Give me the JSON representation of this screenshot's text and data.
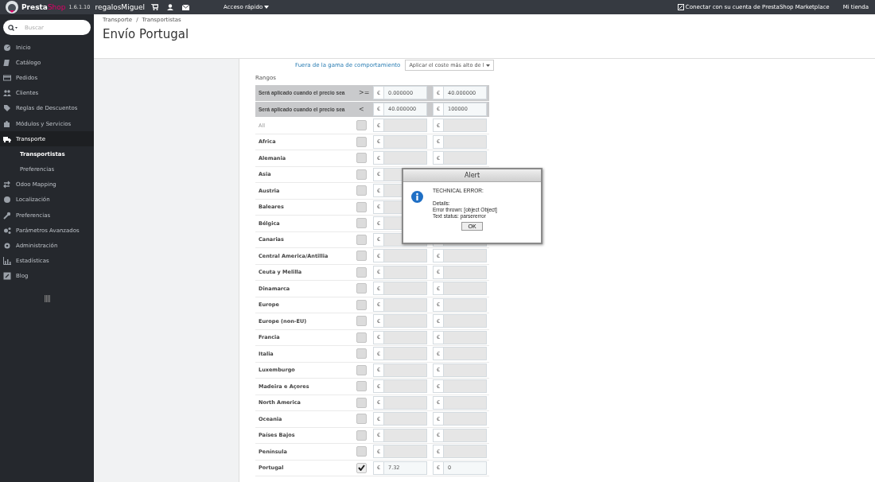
{
  "topbar": {
    "brand_main": "Presta",
    "brand_accent": "Shop",
    "version": "1.6.1.10",
    "shop_name": "regalosMiguel",
    "quick_access": "Acceso rápido",
    "marketplace_link": "Conectar con su cuenta de PrestaShop Marketplace",
    "my_shop": "Mi tienda"
  },
  "sidebar": {
    "search": {
      "placeholder": "Buscar"
    },
    "items": [
      {
        "label": "Inicio",
        "selected": false
      },
      {
        "label": "Catálogo",
        "selected": false
      },
      {
        "label": "Pedidos",
        "selected": false
      },
      {
        "label": "Clientes",
        "selected": false
      },
      {
        "label": "Reglas de Descuentos",
        "selected": false
      },
      {
        "label": "Módulos y Servicios",
        "selected": false
      },
      {
        "label": "Transporte",
        "selected": true,
        "children": [
          {
            "label": "Transportistas",
            "selected": true
          },
          {
            "label": "Preferencias",
            "selected": false
          }
        ]
      },
      {
        "label": "Odoo Mapping",
        "selected": false
      },
      {
        "label": "Localización",
        "selected": false
      },
      {
        "label": "Preferencias",
        "selected": false
      },
      {
        "label": "Parámetros Avanzados",
        "selected": false
      },
      {
        "label": "Administración",
        "selected": false
      },
      {
        "label": "Estadísticas",
        "selected": false
      },
      {
        "label": "Blog",
        "selected": false
      }
    ]
  },
  "header": {
    "breadcrumb": [
      "Transporte",
      "Transportistas"
    ],
    "breadcrumb_separator": "/",
    "title": "Envío Portugal"
  },
  "form": {
    "out_of_range_label": "Fuera de la gama de comportamiento",
    "out_of_range_select": "Aplicar el coste más alto de l",
    "ranges_label": "Rangos",
    "currency": "€",
    "ranges": [
      {
        "label": "Será aplicado cuando el precio sea",
        "operator": ">=",
        "values": [
          "0.000000",
          "40.000000"
        ]
      },
      {
        "label": "Será aplicado cuando el precio sea",
        "operator": "<",
        "values": [
          "40.000000",
          "100000"
        ]
      }
    ],
    "zones": [
      {
        "name": "All",
        "kind": "all",
        "checked": false
      },
      {
        "name": "Africa",
        "kind": "zone",
        "checked": false
      },
      {
        "name": "Alemania",
        "kind": "zone",
        "checked": false
      },
      {
        "name": "Asia",
        "kind": "zone",
        "checked": false
      },
      {
        "name": "Austria",
        "kind": "zone",
        "checked": false
      },
      {
        "name": "Baleares",
        "kind": "zone",
        "checked": false
      },
      {
        "name": "Bélgica",
        "kind": "zone",
        "checked": false
      },
      {
        "name": "Canarias",
        "kind": "zone",
        "checked": false
      },
      {
        "name": "Central America/Antillia",
        "kind": "zone",
        "checked": false
      },
      {
        "name": "Ceuta y Melilla",
        "kind": "zone",
        "checked": false
      },
      {
        "name": "Dinamarca",
        "kind": "zone",
        "checked": false
      },
      {
        "name": "Europe",
        "kind": "zone",
        "checked": false
      },
      {
        "name": "Europe (non-EU)",
        "kind": "zone",
        "checked": false
      },
      {
        "name": "Francia",
        "kind": "zone",
        "checked": false
      },
      {
        "name": "Italia",
        "kind": "zone",
        "checked": false
      },
      {
        "name": "Luxemburgo",
        "kind": "zone",
        "checked": false
      },
      {
        "name": "Madeira e Açores",
        "kind": "zone",
        "checked": false
      },
      {
        "name": "North America",
        "kind": "zone",
        "checked": false
      },
      {
        "name": "Oceania",
        "kind": "zone",
        "checked": false
      },
      {
        "name": "Países Bajos",
        "kind": "zone",
        "checked": false
      },
      {
        "name": "Península",
        "kind": "zone",
        "checked": false
      },
      {
        "name": "Portugal",
        "kind": "zone",
        "checked": true,
        "values": [
          "7.32",
          "0"
        ]
      }
    ]
  },
  "alert": {
    "title": "Alert",
    "message": "TECHNICAL ERROR:\n\nDetails:\nError thrown: [object Object]\nText status: parsererror",
    "button": "OK"
  }
}
